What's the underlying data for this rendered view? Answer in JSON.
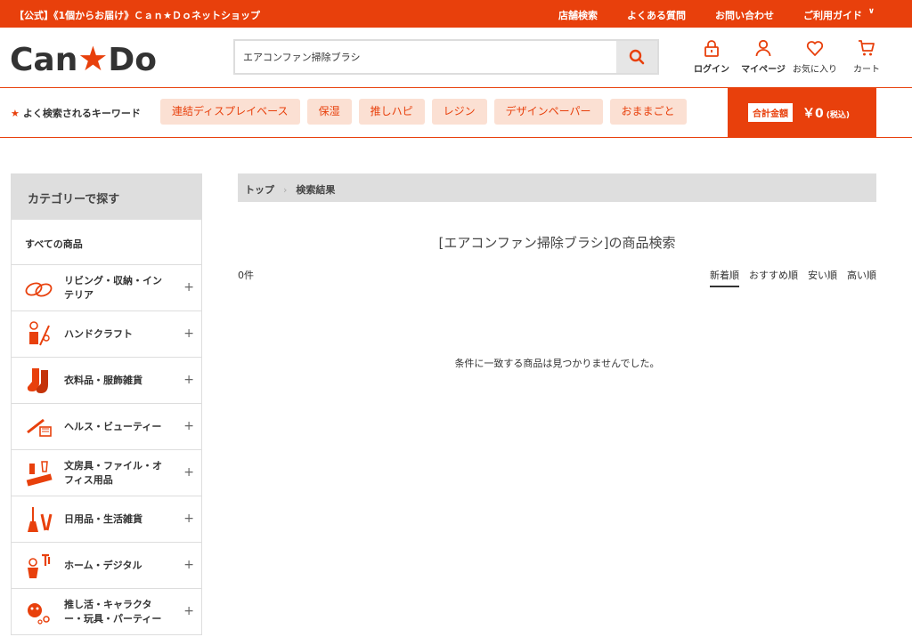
{
  "topbar": {
    "notice": "【公式】《1個からお届け》Ｃａｎ★Ｄｏネットショップ",
    "links": [
      "店舗検索",
      "よくある質問",
      "お問い合わせ",
      "ご利用ガイド"
    ]
  },
  "logo": {
    "left": "Can",
    "star": "★",
    "right": "Do"
  },
  "search": {
    "value": "エアコンファン掃除ブラシ"
  },
  "header_icons": [
    {
      "label": "ログイン",
      "icon": "lock-icon"
    },
    {
      "label": "マイページ",
      "icon": "user-icon"
    },
    {
      "label": "お気に入り",
      "icon": "heart-icon"
    },
    {
      "label": "カート",
      "icon": "cart-icon"
    }
  ],
  "keywords": {
    "label": "よく検索されるキーワード",
    "items": [
      "連結ディスプレイベース",
      "保湿",
      "推しハピ",
      "レジン",
      "デザインペーパー",
      "おままごと"
    ]
  },
  "total": {
    "label": "合計金額",
    "amount": "￥0",
    "tax": "(税込)"
  },
  "sidebar": {
    "heading": "カテゴリーで探す",
    "all": "すべての商品",
    "items": [
      {
        "label": "リビング・収納・インテリア",
        "icon": "slippers-icon"
      },
      {
        "label": "ハンドクラフト",
        "icon": "craft-icon"
      },
      {
        "label": "衣料品・服飾雑貨",
        "icon": "socks-icon"
      },
      {
        "label": "ヘルス・ビューティー",
        "icon": "comb-icon"
      },
      {
        "label": "文房具・ファイル・オフィス用品",
        "icon": "stationery-icon"
      },
      {
        "label": "日用品・生活雑貨",
        "icon": "broom-icon"
      },
      {
        "label": "ホーム・デジタル",
        "icon": "tools-icon"
      },
      {
        "label": "推し活・キャラクター・玩具・パーティー",
        "icon": "party-icon"
      }
    ]
  },
  "breadcrumb": {
    "home": "トップ",
    "sep": "›",
    "current": "検索結果"
  },
  "main": {
    "title": "[エアコンファン掃除ブラシ]の商品検索",
    "count": "0件",
    "sorts": [
      "新着順",
      "おすすめ順",
      "安い順",
      "高い順"
    ],
    "empty": "条件に一致する商品は見つかりませんでした。"
  },
  "colors": {
    "accent": "#e8400c",
    "chip_bg": "#fbe0d3",
    "gray": "#dedede"
  }
}
